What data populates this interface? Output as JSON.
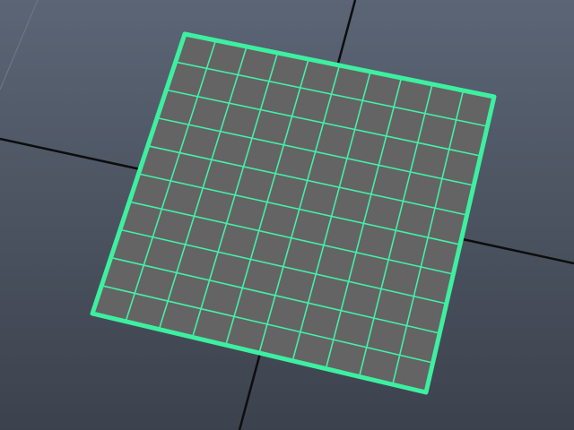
{
  "viewport": {
    "background_top": "#5b6575",
    "background_bottom": "#3c424d"
  },
  "axes": {
    "color": "#0d0d0d"
  },
  "plane": {
    "fill": "#646464",
    "edge_color": "#3df0a0",
    "wire_color": "#43f0a8",
    "subdivisions_width": 10,
    "subdivisions_height": 10,
    "selected": true
  }
}
